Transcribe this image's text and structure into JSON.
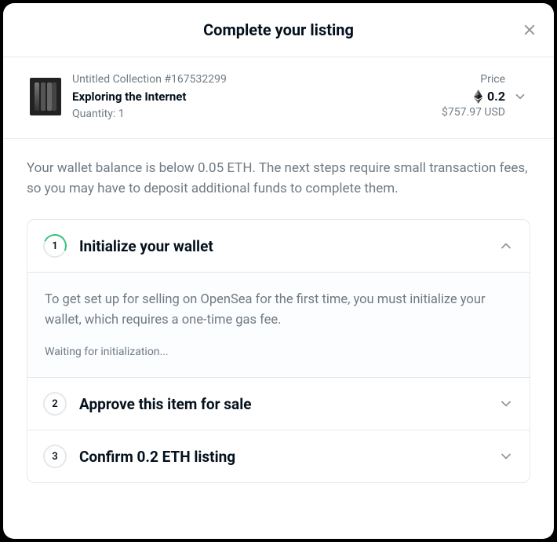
{
  "header": {
    "title": "Complete your listing"
  },
  "summary": {
    "collection": "Untitled Collection #167532299",
    "item_name": "Exploring the Internet",
    "quantity": "Quantity: 1",
    "price_label": "Price",
    "price_value": "0.2",
    "price_currency": "ETH",
    "usd": "$757.97 USD"
  },
  "warning": "Your wallet balance is below 0.05 ETH. The next steps require small transaction fees, so you may have to deposit additional funds to complete them.",
  "steps": [
    {
      "num": "1",
      "title": "Initialize your wallet",
      "expanded": true,
      "desc": "To get set up for selling on OpenSea for the first time, you must initialize your wallet, which requires a one-time gas fee.",
      "status": "Waiting for initialization..."
    },
    {
      "num": "2",
      "title": "Approve this item for sale",
      "expanded": false
    },
    {
      "num": "3",
      "title": "Confirm 0.2 ETH listing",
      "expanded": false
    }
  ]
}
